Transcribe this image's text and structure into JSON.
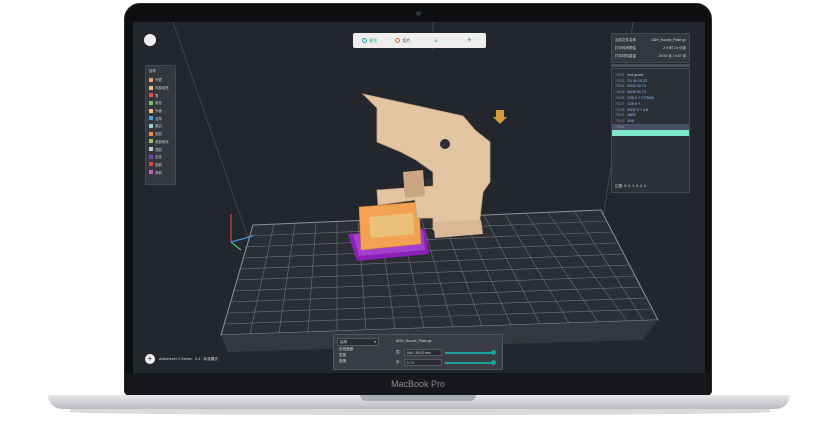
{
  "device": {
    "brand_label": "MacBook Pro"
  },
  "toolbar": {
    "items": [
      {
        "label": "预览",
        "icon": "preview-icon"
      },
      {
        "label": "切片",
        "icon": "slice-icon"
      },
      {
        "label": "",
        "icon": "move-icon"
      },
      {
        "label": "",
        "icon": "print-icon"
      }
    ]
  },
  "legend": {
    "title": "结构",
    "items": [
      {
        "label": "外壁",
        "color": "#f1a05a"
      },
      {
        "label": "内部填充",
        "color": "#e2c08a"
      },
      {
        "label": "表",
        "color": "#e0503b"
      },
      {
        "label": "填充",
        "color": "#6fbf5b"
      },
      {
        "label": "外墙",
        "color": "#f2c26a"
      },
      {
        "label": "支撑",
        "color": "#4d9fe6"
      },
      {
        "label": "裙边",
        "color": "#8bd1d6"
      },
      {
        "label": "底层",
        "color": "#ef8a3c"
      },
      {
        "label": "底部填充",
        "color": "#9bc25c"
      },
      {
        "label": "顶层",
        "color": "#c2c6cc"
      },
      {
        "label": "空走",
        "color": "#7a3fb8"
      },
      {
        "label": "回抽",
        "color": "#d94444"
      },
      {
        "label": "其他",
        "color": "#c85fbf"
      }
    ]
  },
  "info_panel": {
    "rows": [
      {
        "label": "当前文件名称",
        "value": "ADH_Nozzle_Plate.gx"
      },
      {
        "label": "打印时间预估",
        "value": "2 小时 24 分钟"
      },
      {
        "label": "打印材料重量",
        "value": "29.93 克 / 9.87 米"
      }
    ]
  },
  "gcode": {
    "lines": [
      {
        "num": "70132",
        "text": "end gcode",
        "style": "normal"
      },
      {
        "num": "70133",
        "text": "G1 X0 Y0 Z3",
        "style": "normal"
      },
      {
        "num": "70134",
        "text": "M104 S0 T0",
        "style": "normal"
      },
      {
        "num": "70135",
        "text": "M140 S0 T0",
        "style": "normal"
      },
      {
        "num": "70136",
        "text": "G28 X Y Z F3000",
        "style": "normal"
      },
      {
        "num": "70137",
        "text": "G28 X Y",
        "style": "normal"
      },
      {
        "num": "70138",
        "text": "M132 X Y A B",
        "style": "normal"
      },
      {
        "num": "70139",
        "text": "M652",
        "style": "normal"
      },
      {
        "num": "70140",
        "text": "M18",
        "style": "normal"
      },
      {
        "num": "70141",
        "text": "",
        "style": "sel"
      },
      {
        "num": "",
        "text": "",
        "style": "hi"
      }
    ],
    "coords": "位置: X: 0, Y: 0, Z: 0"
  },
  "bottom_panel": {
    "select_value": "结构",
    "options": [
      "走线速度",
      "层高",
      "宽度"
    ],
    "file_name": "ADH_Nozzle_Plate.gx",
    "layer_label": "层:",
    "layer_value": "446 / 89.57mm",
    "step_label": "步:",
    "step_value": "0 / 0",
    "layer_progress": 0.98,
    "step_progress": 0.98
  },
  "status_bar": {
    "add_symbol": "+",
    "machine_text": "Adventurer 4 Series - 0.4 - 标准模式"
  },
  "colors": {
    "accent": "#1aa39a",
    "model_wood": "#e2c3a0",
    "model_orange": "#f3a253",
    "raft_purple": "#8b1fb8",
    "grid": "#8e929b",
    "background": "#23262c"
  }
}
